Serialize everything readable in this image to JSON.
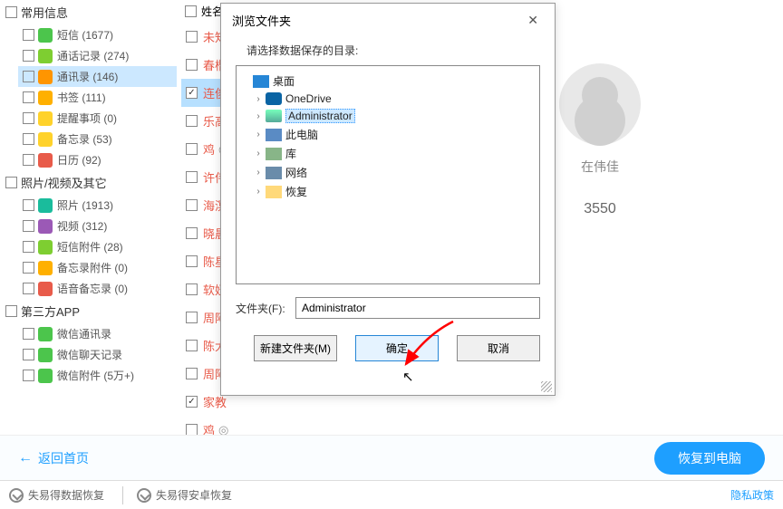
{
  "categories": [
    {
      "title": "常用信息",
      "items": [
        {
          "label": "短信 (1677)",
          "iconClass": "ic-green"
        },
        {
          "label": "通话记录 (274)",
          "iconClass": "ic-lime"
        },
        {
          "label": "通讯录 (146)",
          "iconClass": "ic-org",
          "selected": true
        },
        {
          "label": "书签 (111)",
          "iconClass": "ic-org2"
        },
        {
          "label": "提醒事项 (0)",
          "iconClass": "ic-yel"
        },
        {
          "label": "备忘录 (53)",
          "iconClass": "ic-yel"
        },
        {
          "label": "日历 (92)",
          "iconClass": "ic-red"
        }
      ]
    },
    {
      "title": "照片/视频及其它",
      "items": [
        {
          "label": "照片 (1913)",
          "iconClass": "ic-teal"
        },
        {
          "label": "视频 (312)",
          "iconClass": "ic-pur"
        },
        {
          "label": "短信附件 (28)",
          "iconClass": "ic-lime"
        },
        {
          "label": "备忘录附件 (0)",
          "iconClass": "ic-org2"
        },
        {
          "label": "语音备忘录 (0)",
          "iconClass": "ic-red"
        }
      ]
    },
    {
      "title": "第三方APP",
      "items": [
        {
          "label": "微信通讯录",
          "iconClass": "ic-green"
        },
        {
          "label": "微信聊天记录",
          "iconClass": "ic-green"
        },
        {
          "label": "微信附件 (5万+)",
          "iconClass": "ic-green"
        }
      ]
    }
  ],
  "mid": {
    "header": "姓名",
    "rows": [
      {
        "t": "未知",
        "checked": false
      },
      {
        "t": "春楷",
        "checked": false
      },
      {
        "t": "连俊",
        "checked": true,
        "hl": true
      },
      {
        "t": "乐高",
        "checked": false
      },
      {
        "t": "鸡",
        "fade": "◎",
        "checked": false
      },
      {
        "t": "许伟",
        "checked": false
      },
      {
        "t": "海溟",
        "checked": false
      },
      {
        "t": "晓晨",
        "checked": false
      },
      {
        "t": "陈星",
        "checked": false
      },
      {
        "t": "软妞",
        "checked": false
      },
      {
        "t": "周阿",
        "checked": false
      },
      {
        "t": "陈大",
        "checked": false
      },
      {
        "t": "周阿",
        "checked": false
      },
      {
        "t": "家教",
        "checked": true
      },
      {
        "t": "鸡",
        "fade": "◎",
        "checked": false
      }
    ]
  },
  "detail": {
    "name": "在伟佳",
    "phone": "3550"
  },
  "bottom": {
    "back": "返回首页",
    "restore": "恢复到电脑"
  },
  "footer": {
    "a": "失易得数据恢复",
    "b": "失易得安卓恢复",
    "privacy": "隐私政策"
  },
  "dialog": {
    "title": "浏览文件夹",
    "subtitle": "请选择数据保存的目录:",
    "tree": [
      {
        "label": "桌面",
        "iconClass": "ti-desktop",
        "level": 1,
        "exp": ""
      },
      {
        "label": "OneDrive",
        "iconClass": "ti-onedrive",
        "level": 2,
        "exp": "›"
      },
      {
        "label": "Administrator",
        "iconClass": "ti-user",
        "level": 2,
        "exp": "›",
        "selected": true
      },
      {
        "label": "此电脑",
        "iconClass": "ti-pc",
        "level": 2,
        "exp": "›"
      },
      {
        "label": "库",
        "iconClass": "ti-lib",
        "level": 2,
        "exp": "›"
      },
      {
        "label": "网络",
        "iconClass": "ti-net",
        "level": 2,
        "exp": "›"
      },
      {
        "label": "恢复",
        "iconClass": "ti-folder",
        "level": 2,
        "exp": "›"
      }
    ],
    "folderLabel": "文件夹(F):",
    "folderValue": "Administrator",
    "btnNew": "新建文件夹(M)",
    "btnOk": "确定",
    "btnCancel": "取消"
  }
}
